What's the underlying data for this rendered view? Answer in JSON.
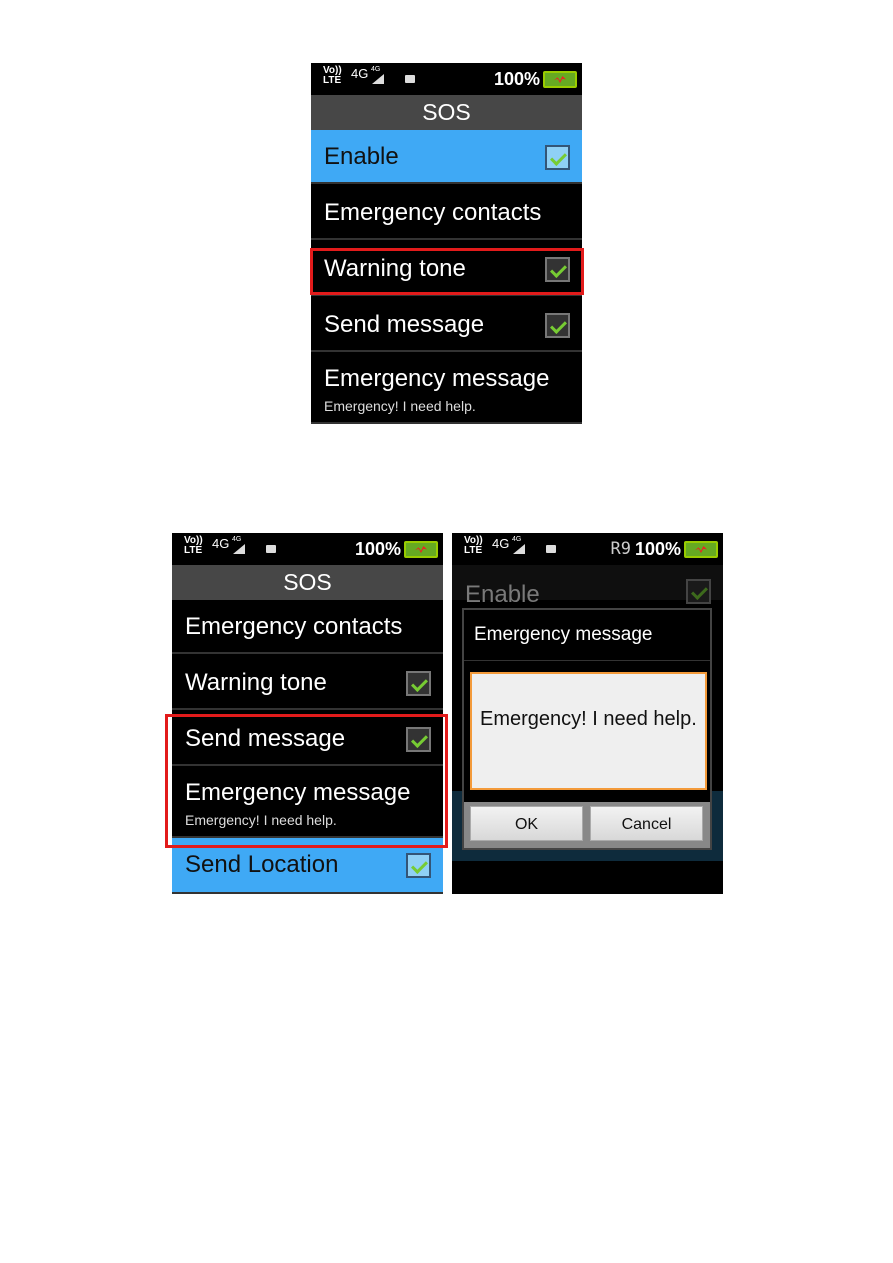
{
  "status": {
    "volte": "Vo))",
    "lte": "LTE",
    "network": "4G",
    "signal_label": "4G",
    "battery": "100%",
    "roaming": "R9"
  },
  "screen1": {
    "title": "SOS",
    "rows": [
      {
        "label": "Enable",
        "checked": true
      },
      {
        "label": "Emergency contacts"
      },
      {
        "label": "Warning tone",
        "checked": true
      },
      {
        "label": "Send message",
        "checked": true
      },
      {
        "label": "Emergency message",
        "sub": "Emergency! I need help."
      }
    ]
  },
  "screen2": {
    "title": "SOS",
    "rows": [
      {
        "label": "Emergency contacts"
      },
      {
        "label": "Warning tone",
        "checked": true
      },
      {
        "label": "Send message",
        "checked": true
      },
      {
        "label": "Emergency message",
        "sub": "Emergency! I need help."
      },
      {
        "label": "Send Location",
        "checked": true
      }
    ]
  },
  "screen3": {
    "background_row": "Enable",
    "dialog": {
      "title": "Emergency message",
      "value": "Emergency! I need help.",
      "ok": "OK",
      "cancel": "Cancel"
    }
  },
  "colors": {
    "highlight_row": "#3fa9f5",
    "annotation_box": "#e21b1b",
    "input_border": "#f39a3a"
  }
}
